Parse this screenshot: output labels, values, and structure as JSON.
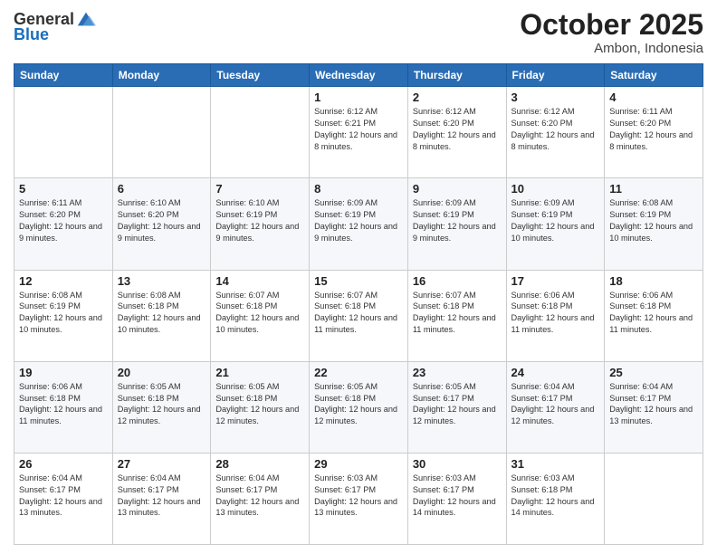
{
  "header": {
    "logo_general": "General",
    "logo_blue": "Blue",
    "month_title": "October 2025",
    "location": "Ambon, Indonesia"
  },
  "days_of_week": [
    "Sunday",
    "Monday",
    "Tuesday",
    "Wednesday",
    "Thursday",
    "Friday",
    "Saturday"
  ],
  "weeks": [
    [
      {
        "day": "",
        "info": ""
      },
      {
        "day": "",
        "info": ""
      },
      {
        "day": "",
        "info": ""
      },
      {
        "day": "1",
        "info": "Sunrise: 6:12 AM\nSunset: 6:21 PM\nDaylight: 12 hours and 8 minutes."
      },
      {
        "day": "2",
        "info": "Sunrise: 6:12 AM\nSunset: 6:20 PM\nDaylight: 12 hours and 8 minutes."
      },
      {
        "day": "3",
        "info": "Sunrise: 6:12 AM\nSunset: 6:20 PM\nDaylight: 12 hours and 8 minutes."
      },
      {
        "day": "4",
        "info": "Sunrise: 6:11 AM\nSunset: 6:20 PM\nDaylight: 12 hours and 8 minutes."
      }
    ],
    [
      {
        "day": "5",
        "info": "Sunrise: 6:11 AM\nSunset: 6:20 PM\nDaylight: 12 hours and 9 minutes."
      },
      {
        "day": "6",
        "info": "Sunrise: 6:10 AM\nSunset: 6:20 PM\nDaylight: 12 hours and 9 minutes."
      },
      {
        "day": "7",
        "info": "Sunrise: 6:10 AM\nSunset: 6:19 PM\nDaylight: 12 hours and 9 minutes."
      },
      {
        "day": "8",
        "info": "Sunrise: 6:09 AM\nSunset: 6:19 PM\nDaylight: 12 hours and 9 minutes."
      },
      {
        "day": "9",
        "info": "Sunrise: 6:09 AM\nSunset: 6:19 PM\nDaylight: 12 hours and 9 minutes."
      },
      {
        "day": "10",
        "info": "Sunrise: 6:09 AM\nSunset: 6:19 PM\nDaylight: 12 hours and 10 minutes."
      },
      {
        "day": "11",
        "info": "Sunrise: 6:08 AM\nSunset: 6:19 PM\nDaylight: 12 hours and 10 minutes."
      }
    ],
    [
      {
        "day": "12",
        "info": "Sunrise: 6:08 AM\nSunset: 6:19 PM\nDaylight: 12 hours and 10 minutes."
      },
      {
        "day": "13",
        "info": "Sunrise: 6:08 AM\nSunset: 6:18 PM\nDaylight: 12 hours and 10 minutes."
      },
      {
        "day": "14",
        "info": "Sunrise: 6:07 AM\nSunset: 6:18 PM\nDaylight: 12 hours and 10 minutes."
      },
      {
        "day": "15",
        "info": "Sunrise: 6:07 AM\nSunset: 6:18 PM\nDaylight: 12 hours and 11 minutes."
      },
      {
        "day": "16",
        "info": "Sunrise: 6:07 AM\nSunset: 6:18 PM\nDaylight: 12 hours and 11 minutes."
      },
      {
        "day": "17",
        "info": "Sunrise: 6:06 AM\nSunset: 6:18 PM\nDaylight: 12 hours and 11 minutes."
      },
      {
        "day": "18",
        "info": "Sunrise: 6:06 AM\nSunset: 6:18 PM\nDaylight: 12 hours and 11 minutes."
      }
    ],
    [
      {
        "day": "19",
        "info": "Sunrise: 6:06 AM\nSunset: 6:18 PM\nDaylight: 12 hours and 11 minutes."
      },
      {
        "day": "20",
        "info": "Sunrise: 6:05 AM\nSunset: 6:18 PM\nDaylight: 12 hours and 12 minutes."
      },
      {
        "day": "21",
        "info": "Sunrise: 6:05 AM\nSunset: 6:18 PM\nDaylight: 12 hours and 12 minutes."
      },
      {
        "day": "22",
        "info": "Sunrise: 6:05 AM\nSunset: 6:18 PM\nDaylight: 12 hours and 12 minutes."
      },
      {
        "day": "23",
        "info": "Sunrise: 6:05 AM\nSunset: 6:17 PM\nDaylight: 12 hours and 12 minutes."
      },
      {
        "day": "24",
        "info": "Sunrise: 6:04 AM\nSunset: 6:17 PM\nDaylight: 12 hours and 12 minutes."
      },
      {
        "day": "25",
        "info": "Sunrise: 6:04 AM\nSunset: 6:17 PM\nDaylight: 12 hours and 13 minutes."
      }
    ],
    [
      {
        "day": "26",
        "info": "Sunrise: 6:04 AM\nSunset: 6:17 PM\nDaylight: 12 hours and 13 minutes."
      },
      {
        "day": "27",
        "info": "Sunrise: 6:04 AM\nSunset: 6:17 PM\nDaylight: 12 hours and 13 minutes."
      },
      {
        "day": "28",
        "info": "Sunrise: 6:04 AM\nSunset: 6:17 PM\nDaylight: 12 hours and 13 minutes."
      },
      {
        "day": "29",
        "info": "Sunrise: 6:03 AM\nSunset: 6:17 PM\nDaylight: 12 hours and 13 minutes."
      },
      {
        "day": "30",
        "info": "Sunrise: 6:03 AM\nSunset: 6:17 PM\nDaylight: 12 hours and 14 minutes."
      },
      {
        "day": "31",
        "info": "Sunrise: 6:03 AM\nSunset: 6:18 PM\nDaylight: 12 hours and 14 minutes."
      },
      {
        "day": "",
        "info": ""
      }
    ]
  ]
}
